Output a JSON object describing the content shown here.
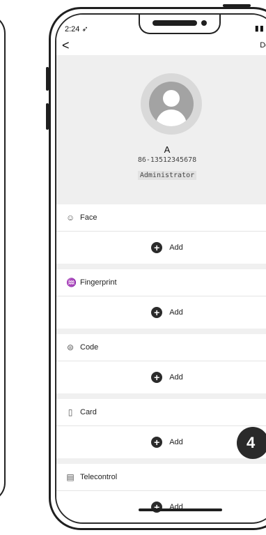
{
  "status_bar": {
    "time": "2:24",
    "location_icon": "location-arrow-icon",
    "right_icons": [
      "signal-icon",
      "wifi-icon"
    ]
  },
  "nav": {
    "back_label": "<",
    "delete_label": "Delete"
  },
  "user": {
    "name": "A",
    "phone": "86-13512345678",
    "role": "Administrator"
  },
  "sections": [
    {
      "label": "Face",
      "icon": "face-icon",
      "add_label": "Add"
    },
    {
      "label": "Fingerprint",
      "icon": "fingerprint-icon",
      "add_label": "Add"
    },
    {
      "label": "Code",
      "icon": "code-icon",
      "add_label": "Add"
    },
    {
      "label": "Card",
      "icon": "card-icon",
      "add_label": "Add"
    },
    {
      "label": "Telecontrol",
      "icon": "remote-control-icon",
      "add_label": "Add"
    }
  ],
  "step_badge": "4"
}
